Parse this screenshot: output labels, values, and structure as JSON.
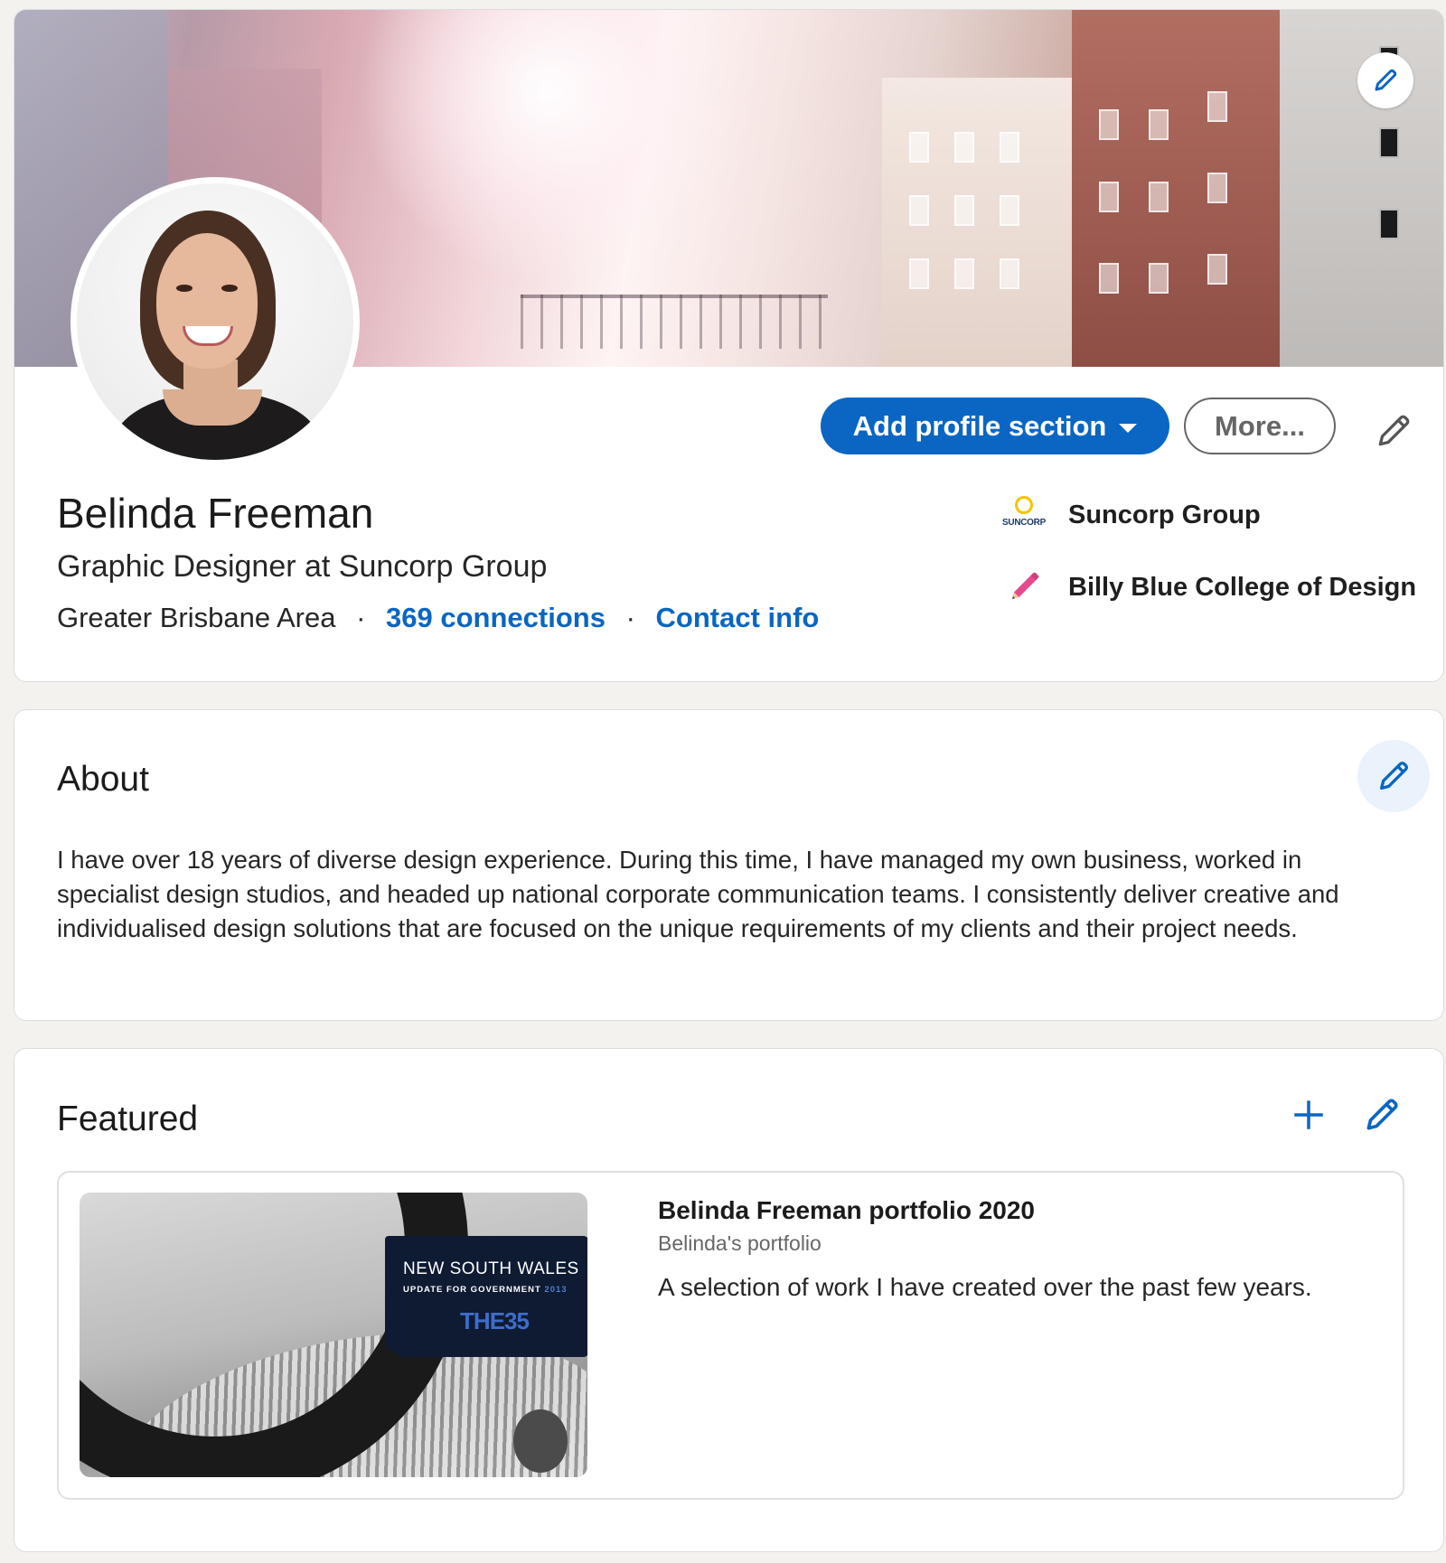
{
  "intro": {
    "name": "Belinda Freeman",
    "headline": "Graphic Designer at Suncorp Group",
    "location": "Greater Brisbane Area",
    "separator": "·",
    "connections": "369 connections",
    "contact_info": "Contact info",
    "add_section_label": "Add profile section",
    "more_label": "More...",
    "orgs": [
      {
        "name": "Suncorp Group",
        "logo_text": "SUNCORP",
        "icon": "suncorp-logo"
      },
      {
        "name": "Billy Blue College of Design",
        "icon": "pencil-logo"
      }
    ]
  },
  "about": {
    "title": "About",
    "text": "I have over 18 years of diverse design experience. During this time, I have managed my own business, worked in specialist design studios, and headed up national corporate communication teams. I consistently deliver creative and individualised design solutions that are focused on the unique requirements of my clients and their project needs."
  },
  "featured": {
    "title": "Featured",
    "item": {
      "title": "Belinda Freeman portfolio 2020",
      "subtitle": "Belinda's portfolio",
      "description": "A selection of work I have created over the past few years.",
      "thumb_badge_title": "NEW SOUTH WALES",
      "thumb_badge_sub": "UPDATE FOR GOVERNMENT",
      "thumb_badge_year": "2013",
      "thumb_badge_logo": "THE35"
    }
  },
  "colors": {
    "accent": "#0a66c2",
    "page_bg": "#f3f2ef"
  }
}
